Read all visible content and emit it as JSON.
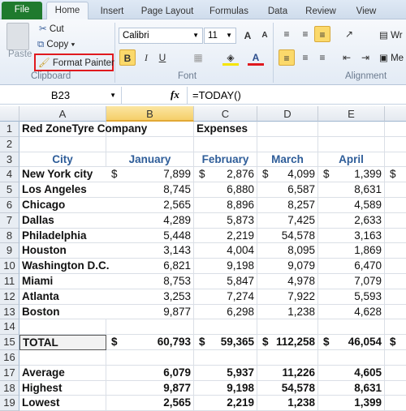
{
  "tabs": [
    "File",
    "Home",
    "Insert",
    "Page Layout",
    "Formulas",
    "Data",
    "Review",
    "View"
  ],
  "clipboard": {
    "paste": "Paste",
    "cut": "Cut",
    "copy": "Copy",
    "format_painter": "Format Painter",
    "label": "Clipboard"
  },
  "font": {
    "name": "Calibri",
    "size": "11",
    "label": "Font",
    "bold": "B",
    "italic": "I",
    "underline": "U"
  },
  "alignment": {
    "label": "Alignment",
    "wrap": "Wr",
    "merge": "Me"
  },
  "formula_bar": {
    "name_box": "B23",
    "fx": "fx",
    "formula": "=TODAY()"
  },
  "columns": [
    "A",
    "B",
    "C",
    "D",
    "E"
  ],
  "rows": [
    {
      "n": "1",
      "a": "Red ZoneTyre Company",
      "b": "",
      "c": "Expenses",
      "d": "",
      "e": ""
    },
    {
      "n": "2",
      "a": "",
      "b": "",
      "c": "",
      "d": "",
      "e": ""
    },
    {
      "n": "3",
      "a": "City",
      "b": "January",
      "c": "February",
      "d": "March",
      "e": "April"
    },
    {
      "n": "4",
      "a": "New York city",
      "b": "7,899",
      "c": "2,876",
      "d": "4,099",
      "e": "1,399"
    },
    {
      "n": "5",
      "a": "Los Angeles",
      "b": "8,745",
      "c": "6,880",
      "d": "6,587",
      "e": "8,631"
    },
    {
      "n": "6",
      "a": "Chicago",
      "b": "2,565",
      "c": "8,896",
      "d": "8,257",
      "e": "4,589"
    },
    {
      "n": "7",
      "a": "Dallas",
      "b": "4,289",
      "c": "5,873",
      "d": "7,425",
      "e": "2,633"
    },
    {
      "n": "8",
      "a": "Philadelphia",
      "b": "5,448",
      "c": "2,219",
      "d": "54,578",
      "e": "3,163"
    },
    {
      "n": "9",
      "a": "Houston",
      "b": "3,143",
      "c": "4,004",
      "d": "8,095",
      "e": "1,869"
    },
    {
      "n": "10",
      "a": "Washington D.C.",
      "b": "6,821",
      "c": "9,198",
      "d": "9,079",
      "e": "6,470"
    },
    {
      "n": "11",
      "a": "Miami",
      "b": "8,753",
      "c": "5,847",
      "d": "4,978",
      "e": "7,079"
    },
    {
      "n": "12",
      "a": "Atlanta",
      "b": "3,253",
      "c": "7,274",
      "d": "7,922",
      "e": "5,593"
    },
    {
      "n": "13",
      "a": "Boston",
      "b": "9,877",
      "c": "6,298",
      "d": "1,238",
      "e": "4,628"
    },
    {
      "n": "14",
      "a": "",
      "b": "",
      "c": "",
      "d": "",
      "e": ""
    },
    {
      "n": "15",
      "a": "TOTAL",
      "b": "60,793",
      "c": "59,365",
      "d": "112,258",
      "e": "46,054"
    },
    {
      "n": "16",
      "a": "",
      "b": "",
      "c": "",
      "d": "",
      "e": ""
    },
    {
      "n": "17",
      "a": "Average",
      "b": "6,079",
      "c": "5,937",
      "d": "11,226",
      "e": "4,605"
    },
    {
      "n": "18",
      "a": "Highest",
      "b": "9,877",
      "c": "9,198",
      "d": "54,578",
      "e": "8,631"
    },
    {
      "n": "19",
      "a": "Lowest",
      "b": "2,565",
      "c": "2,219",
      "d": "1,238",
      "e": "1,399"
    }
  ],
  "currency_symbol": "$",
  "colors": {
    "file_tab": "#1f7a2e",
    "header_text": "#2e5d99",
    "highlight": "#fbd96b",
    "format_painter_outline": "#e0191e"
  }
}
